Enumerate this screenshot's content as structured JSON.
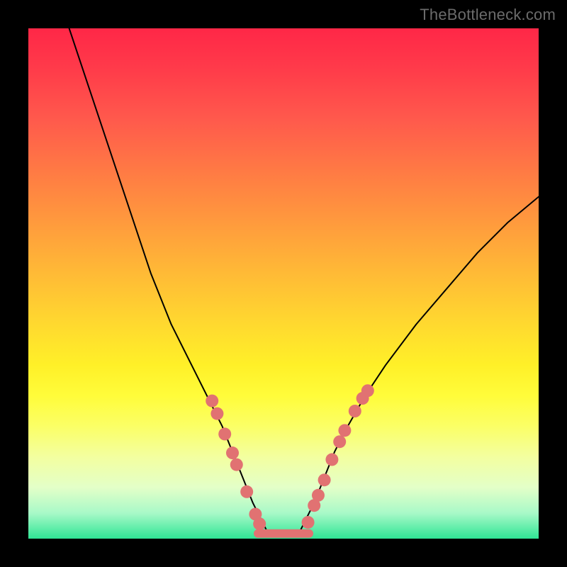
{
  "watermark": "TheBottleneck.com",
  "chart_data": {
    "type": "line",
    "title": "",
    "xlabel": "",
    "ylabel": "",
    "xlim": [
      0,
      100
    ],
    "ylim": [
      0,
      100
    ],
    "grid": false,
    "legend": false,
    "series": [
      {
        "name": "curve-left",
        "stroke": "#000000",
        "stroke_width": 2,
        "x": [
          8,
          12,
          16,
          20,
          24,
          28,
          32,
          36,
          38,
          40,
          42,
          44,
          46,
          47
        ],
        "y": [
          100,
          88,
          76,
          64,
          52,
          42,
          34,
          26,
          22,
          17,
          12,
          7,
          3,
          1
        ]
      },
      {
        "name": "curve-right",
        "stroke": "#000000",
        "stroke_width": 2,
        "x": [
          53,
          54,
          56,
          58,
          60,
          62,
          66,
          70,
          76,
          82,
          88,
          94,
          100
        ],
        "y": [
          1,
          3,
          7,
          12,
          17,
          21,
          28,
          34,
          42,
          49,
          56,
          62,
          67
        ]
      },
      {
        "name": "bottom-flat",
        "stroke": "#e17272",
        "stroke_width": 12,
        "x": [
          45,
          55
        ],
        "y": [
          1,
          1
        ]
      }
    ],
    "scatter": [
      {
        "name": "dots-left",
        "color": "#e17272",
        "radius": 9,
        "points": [
          {
            "x": 36,
            "y": 27
          },
          {
            "x": 37,
            "y": 24.5
          },
          {
            "x": 38.5,
            "y": 20.5
          },
          {
            "x": 40,
            "y": 16.8
          },
          {
            "x": 40.8,
            "y": 14.5
          },
          {
            "x": 42.8,
            "y": 9.2
          },
          {
            "x": 44.5,
            "y": 4.8
          },
          {
            "x": 45.3,
            "y": 2.9
          }
        ]
      },
      {
        "name": "dots-right",
        "color": "#e17272",
        "radius": 9,
        "points": [
          {
            "x": 54.8,
            "y": 3.2
          },
          {
            "x": 56.0,
            "y": 6.5
          },
          {
            "x": 56.8,
            "y": 8.5
          },
          {
            "x": 58.0,
            "y": 11.5
          },
          {
            "x": 59.5,
            "y": 15.5
          },
          {
            "x": 61.0,
            "y": 19.0
          },
          {
            "x": 62.0,
            "y": 21.2
          },
          {
            "x": 64.0,
            "y": 25.0
          },
          {
            "x": 65.5,
            "y": 27.5
          },
          {
            "x": 66.5,
            "y": 29.0
          }
        ]
      }
    ]
  }
}
